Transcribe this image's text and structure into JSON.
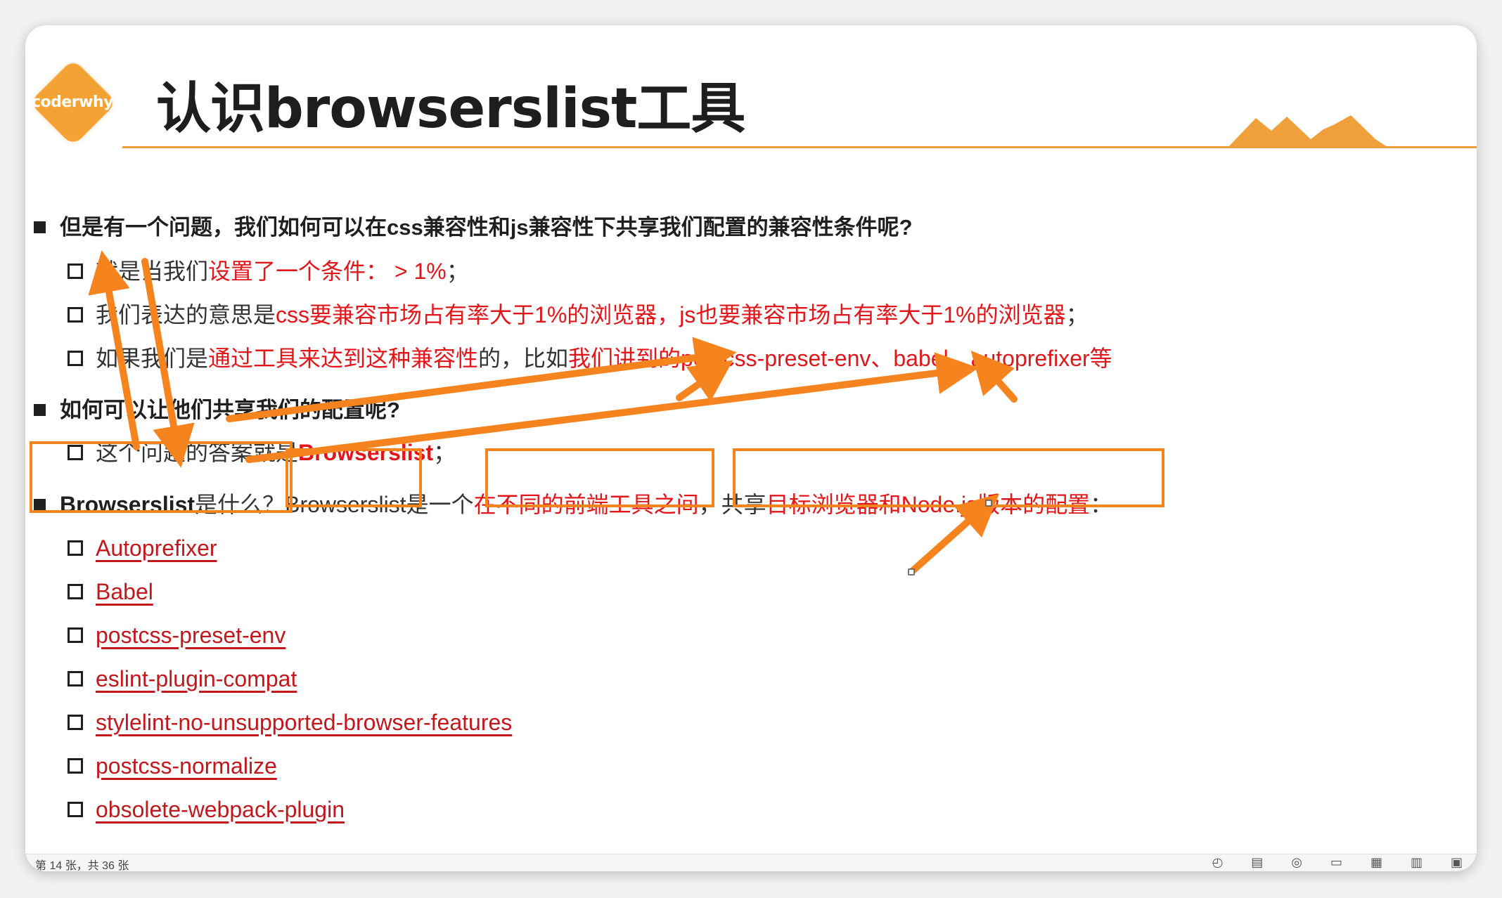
{
  "logo": {
    "text": "coderwhy"
  },
  "title": "认识browserslist工具",
  "bullets": [
    {
      "text": "但是有一个问题，我们如何可以在css兼容性和js兼容性下共享我们配置的兼容性条件呢?"
    },
    {
      "pre": "就是当我们",
      "red": "设置了一个条件：  > 1%",
      "post": "；"
    },
    {
      "pre": "我们表达的意思是",
      "red": "css要兼容市场占有率大于1%的浏览器，js也要兼容市场占有率大于1%的浏览器",
      "post": "；"
    },
    {
      "pre": "如果我们是",
      "red1": "通过工具来达到这种兼容性",
      "mid": "的，比如",
      "red2": "我们讲到的postcss-preset-env、babel、autoprefixer等"
    },
    {
      "text": "如何可以让他们共享我们的配置呢?"
    },
    {
      "pre": "这个问题的答案就是",
      "strong": "Browserslist",
      "post": "；"
    },
    {
      "bold": "Browserslist",
      "q": "是什么？",
      "name": "Browserslist",
      "mid": "是一个",
      "red1": "在不同的前端工具之间",
      "mid2": "，共享",
      "red2": "目标浏览器和Node.js版本的配置",
      "post": "："
    }
  ],
  "tools": [
    "Autoprefixer",
    "Babel",
    "postcss-preset-env",
    "eslint-plugin-compat",
    "stylelint-no-unsupported-browser-features",
    "postcss-normalize",
    "obsolete-webpack-plugin"
  ],
  "status": {
    "page": "第 14 张，共 36 张"
  },
  "colors": {
    "accent": "#f4a233",
    "annotation": "#f5841f",
    "red": "#e0161b"
  }
}
